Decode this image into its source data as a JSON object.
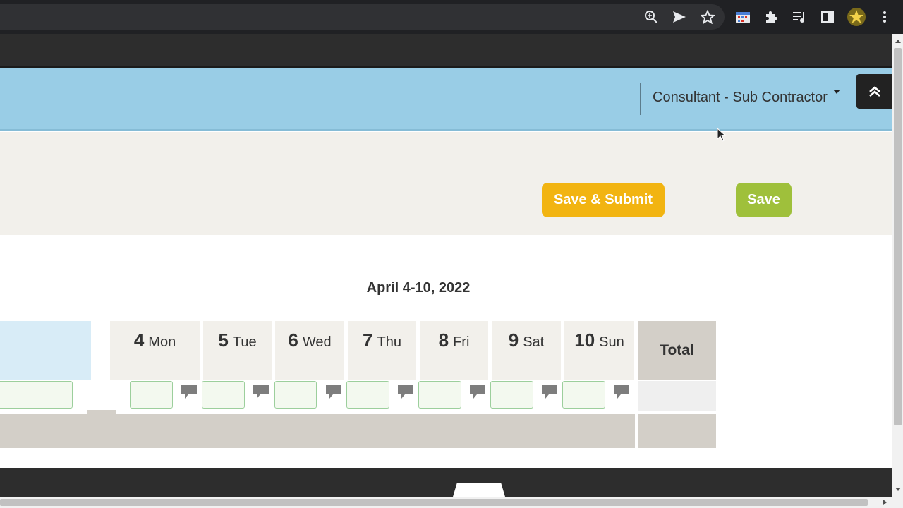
{
  "browser": {
    "icons": [
      "zoom-icon",
      "send-icon",
      "bookmark-star-icon",
      "calendar-extension-icon",
      "extensions-puzzle-icon",
      "media-control-icon",
      "side-panel-icon",
      "profile-avatar",
      "more-menu-icon"
    ]
  },
  "header": {
    "role_label": "Consultant - Sub Contractor"
  },
  "actions": {
    "save_submit_label": "Save & Submit",
    "save_label": "Save",
    "save_submit_color": "#f2b411",
    "save_color": "#9fc03b"
  },
  "timesheet": {
    "week_title": "April 4-10, 2022",
    "days": [
      {
        "num": "4",
        "name": "Mon"
      },
      {
        "num": "5",
        "name": "Tue"
      },
      {
        "num": "6",
        "name": "Wed"
      },
      {
        "num": "7",
        "name": "Thu"
      },
      {
        "num": "8",
        "name": "Fri"
      },
      {
        "num": "9",
        "name": "Sat"
      },
      {
        "num": "10",
        "name": "Sun"
      }
    ],
    "total_label": "Total"
  },
  "colors": {
    "header_blue": "#99cde6",
    "band_beige": "#f2f0eb",
    "total_gray": "#d3cfc8"
  }
}
